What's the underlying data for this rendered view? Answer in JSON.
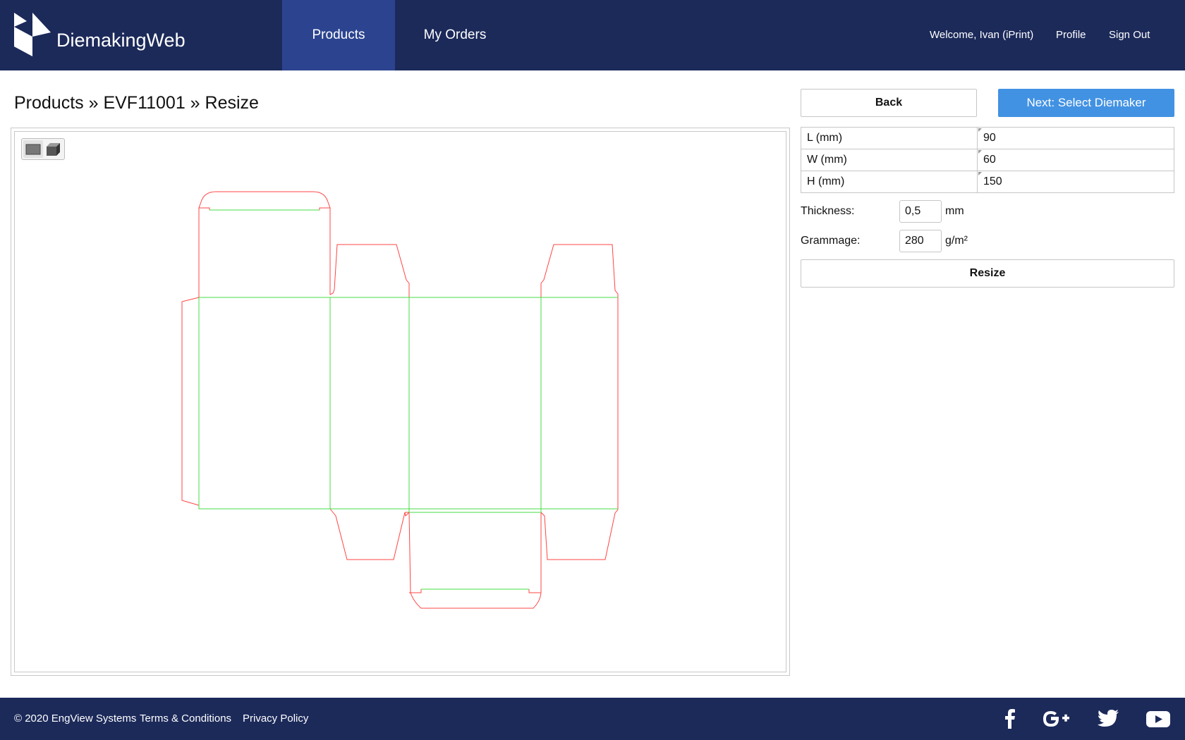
{
  "header": {
    "brand": "DiemakingWeb",
    "nav": [
      {
        "label": "Products",
        "active": true
      },
      {
        "label": "My Orders",
        "active": false
      }
    ],
    "welcome": "Welcome, Ivan (iPrint)",
    "profile": "Profile",
    "sign_out": "Sign Out"
  },
  "page": {
    "title": "Products » EVF11001 » Resize"
  },
  "canvas": {
    "view_modes": [
      "2d-view-icon",
      "3d-view-icon"
    ],
    "active_view": "2d-view-icon",
    "cut_line_color": "#ff3333",
    "crease_line_color": "#33dd33"
  },
  "actions": {
    "back": "Back",
    "next": "Next: Select Diemaker",
    "resize": "Resize"
  },
  "dimensions": [
    {
      "label": "L (mm)",
      "value": "90"
    },
    {
      "label": "W (mm)",
      "value": "60"
    },
    {
      "label": "H (mm)",
      "value": "150"
    }
  ],
  "thickness": {
    "label": "Thickness:",
    "value": "0,5",
    "unit": "mm"
  },
  "grammage": {
    "label": "Grammage:",
    "value": "280",
    "unit": "g/m²"
  },
  "footer": {
    "copyright": "© 2020 EngView Systems",
    "terms": "Terms & Conditions",
    "privacy": "Privacy Policy",
    "social": [
      "facebook-icon",
      "google-plus-icon",
      "twitter-icon",
      "youtube-icon"
    ]
  },
  "colors": {
    "header_bg": "#1c2a5a",
    "nav_active_bg": "#2c4490",
    "primary_button": "#4292e3"
  }
}
